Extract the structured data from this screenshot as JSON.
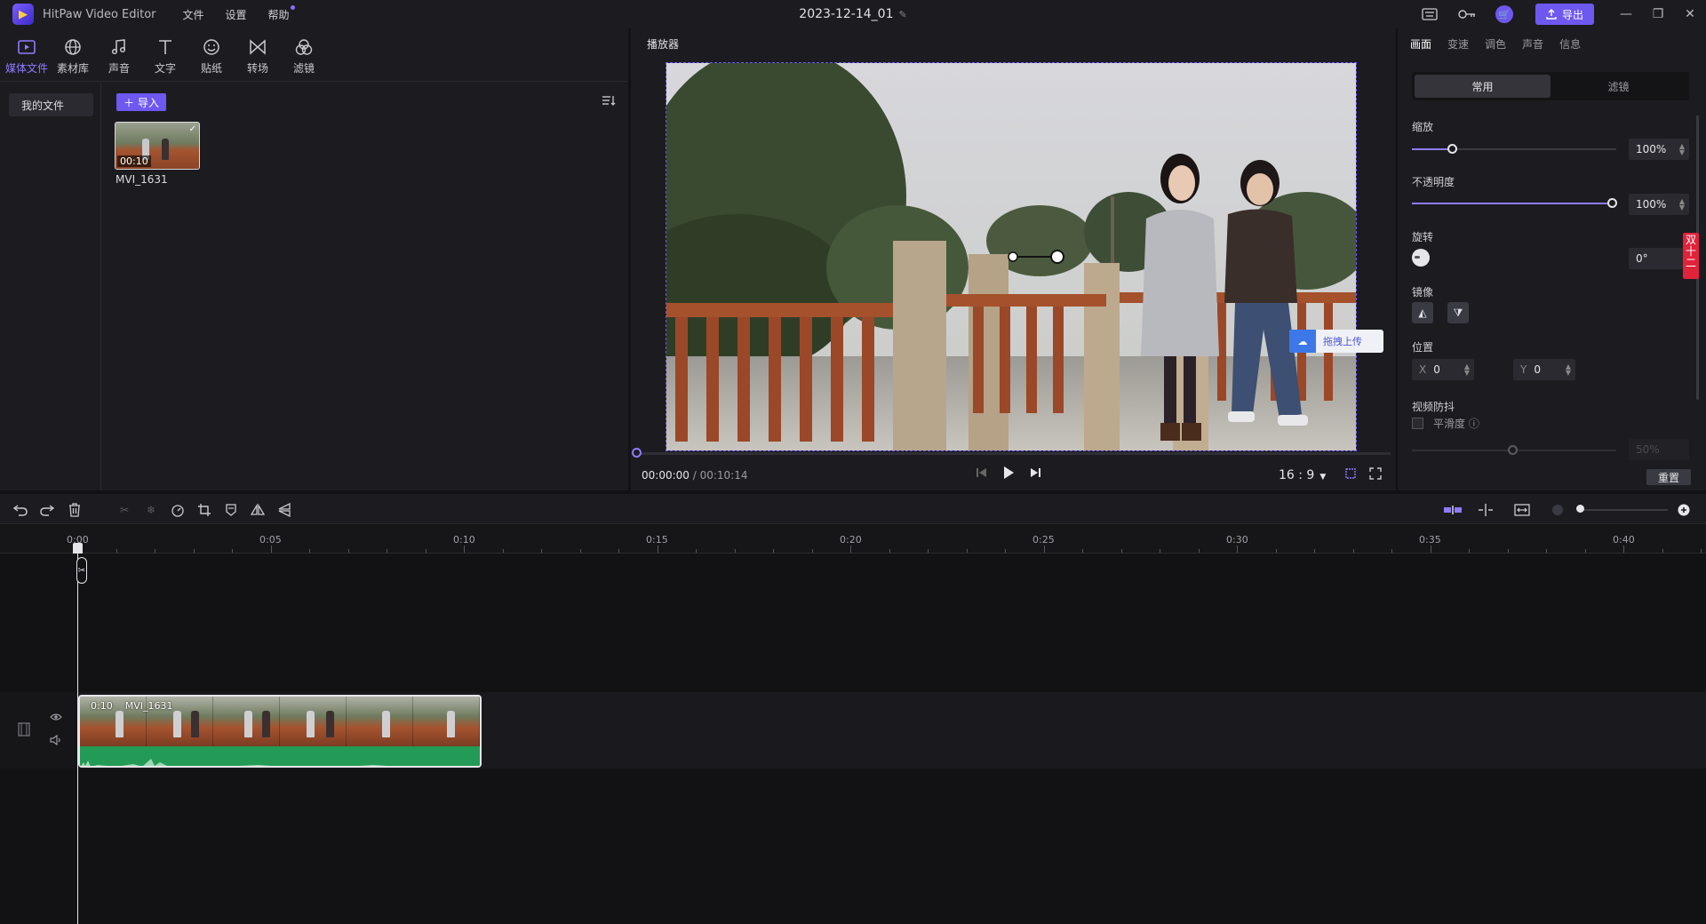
{
  "titlebar": {
    "app_name": "HitPaw Video Editor",
    "menu": [
      "文件",
      "设置",
      "帮助"
    ],
    "project_title": "2023-12-14_01",
    "export_label": "导出"
  },
  "tool_tabs": [
    {
      "label": "媒体文件",
      "icon": "media-icon",
      "active": true
    },
    {
      "label": "素材库",
      "icon": "globe-icon"
    },
    {
      "label": "声音",
      "icon": "music-note-icon"
    },
    {
      "label": "文字",
      "icon": "text-icon"
    },
    {
      "label": "贴纸",
      "icon": "sticker-icon"
    },
    {
      "label": "转场",
      "icon": "transition-icon"
    },
    {
      "label": "滤镜",
      "icon": "filter-icon"
    }
  ],
  "media": {
    "folder_label": "我的文件",
    "import_label": "导入",
    "items": [
      {
        "name": "MVI_1631",
        "duration": "00:10"
      }
    ]
  },
  "player": {
    "header": "播放器",
    "current_time": "00:00:00",
    "total_time": "00:10:14",
    "aspect_ratio": "16 : 9",
    "upload_chip": "拖拽上传",
    "progress_fraction": 0
  },
  "properties": {
    "tabs": [
      "画面",
      "变速",
      "调色",
      "声音",
      "信息"
    ],
    "segments": [
      "常用",
      "滤镜"
    ],
    "scale_label": "缩放",
    "scale_value": "100%",
    "opacity_label": "不透明度",
    "opacity_value": "100%",
    "rotate_label": "旋转",
    "rotate_value": "0°",
    "mirror_label": "镜像",
    "position_label": "位置",
    "pos_x_axis": "X",
    "pos_x": "0",
    "pos_y_axis": "Y",
    "pos_y": "0",
    "stabilize_label": "视频防抖",
    "smooth_label": "平滑度",
    "smooth_value": "50%",
    "reset_label": "重置",
    "promo_text": "双十二"
  },
  "timeline": {
    "ruler_labels": [
      "0:00",
      "0:05",
      "0:10",
      "0:15",
      "0:20",
      "0:25",
      "0:30",
      "0:35",
      "0:40"
    ],
    "clip": {
      "duration": "0:10",
      "name": "MVI_1631"
    }
  },
  "colors": {
    "accent": "#6d58f0",
    "accent_light": "#8f7bff",
    "audio_wave": "#239b56",
    "panel_bg": "#1c1c20",
    "timeline_bg": "#121214"
  }
}
